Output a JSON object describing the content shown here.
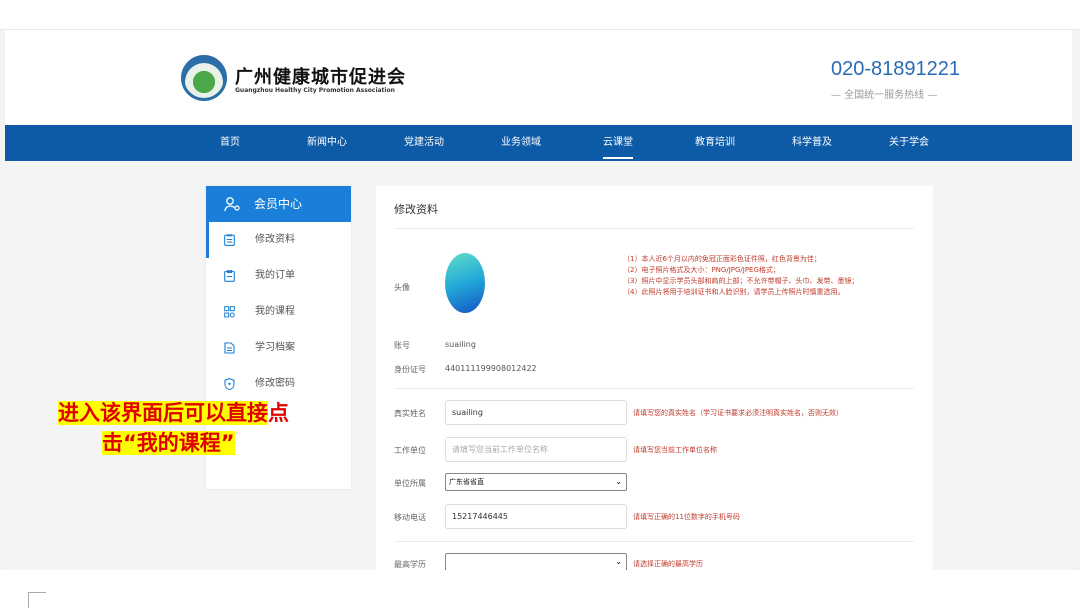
{
  "header": {
    "org_name": "广州健康城市促进会",
    "org_name_en": "Guangzhou Healthy City Promotion Association",
    "hotline": "020-81891221",
    "hotline_sub": "— 全国统一服务热线 —"
  },
  "nav": {
    "items": [
      "首页",
      "新闻中心",
      "党建活动",
      "业务领域",
      "云课堂",
      "教育培训",
      "科学普及",
      "关于学会"
    ],
    "active": "云课堂"
  },
  "sidebar": {
    "title": "会员中心",
    "items": [
      {
        "label": "修改资料",
        "icon": "clipboard-icon"
      },
      {
        "label": "我的订单",
        "icon": "order-icon"
      },
      {
        "label": "我的课程",
        "icon": "course-icon"
      },
      {
        "label": "学习档案",
        "icon": "archive-icon"
      },
      {
        "label": "修改密码",
        "icon": "shield-icon"
      }
    ]
  },
  "form": {
    "title": "修改资料",
    "avatar_label": "头像",
    "notes": [
      "（1）本人近6个月以内的免冠正面彩色证件照，红色背景为佳；",
      "（2）电子照片格式及大小：PNG/JPG/JPEG格式；",
      "（3）照片中显示学员头部和肩的上部；不允许带帽子、头巾、发带、墨镜；",
      "（4）此照片将用于培训证书和人脸识别，请学员上传照片时慎重选用。"
    ],
    "account_label": "账号",
    "account_value": "suailing",
    "id_label": "身份证号",
    "id_value": "440111199908012422",
    "name_label": "真实姓名",
    "name_value": "suailing",
    "name_hint": "请填写您的真实姓名（学习证书要求必须注明真实姓名，否则无效）",
    "work_label": "工作单位",
    "work_placeholder": "请填写您当前工作单位名称",
    "work_hint": "请填写您当前工作单位名称",
    "unit_label": "单位所属",
    "unit_value": "广东省省直",
    "phone_label": "移动电话",
    "phone_value": "15217446445",
    "phone_hint": "请填写正确的11位数字的手机号码",
    "edu_label": "最高学历",
    "edu_value": "",
    "edu_hint": "请选择正确的最高学历"
  },
  "annotation": {
    "line1_highlight": "进入该界面后可以直接",
    "line1_rest": "点",
    "line2": "击“我的课程”"
  },
  "colors": {
    "nav_bg": "#0d5aa7",
    "accent": "#1a7fd8",
    "hint": "#c0392b"
  }
}
